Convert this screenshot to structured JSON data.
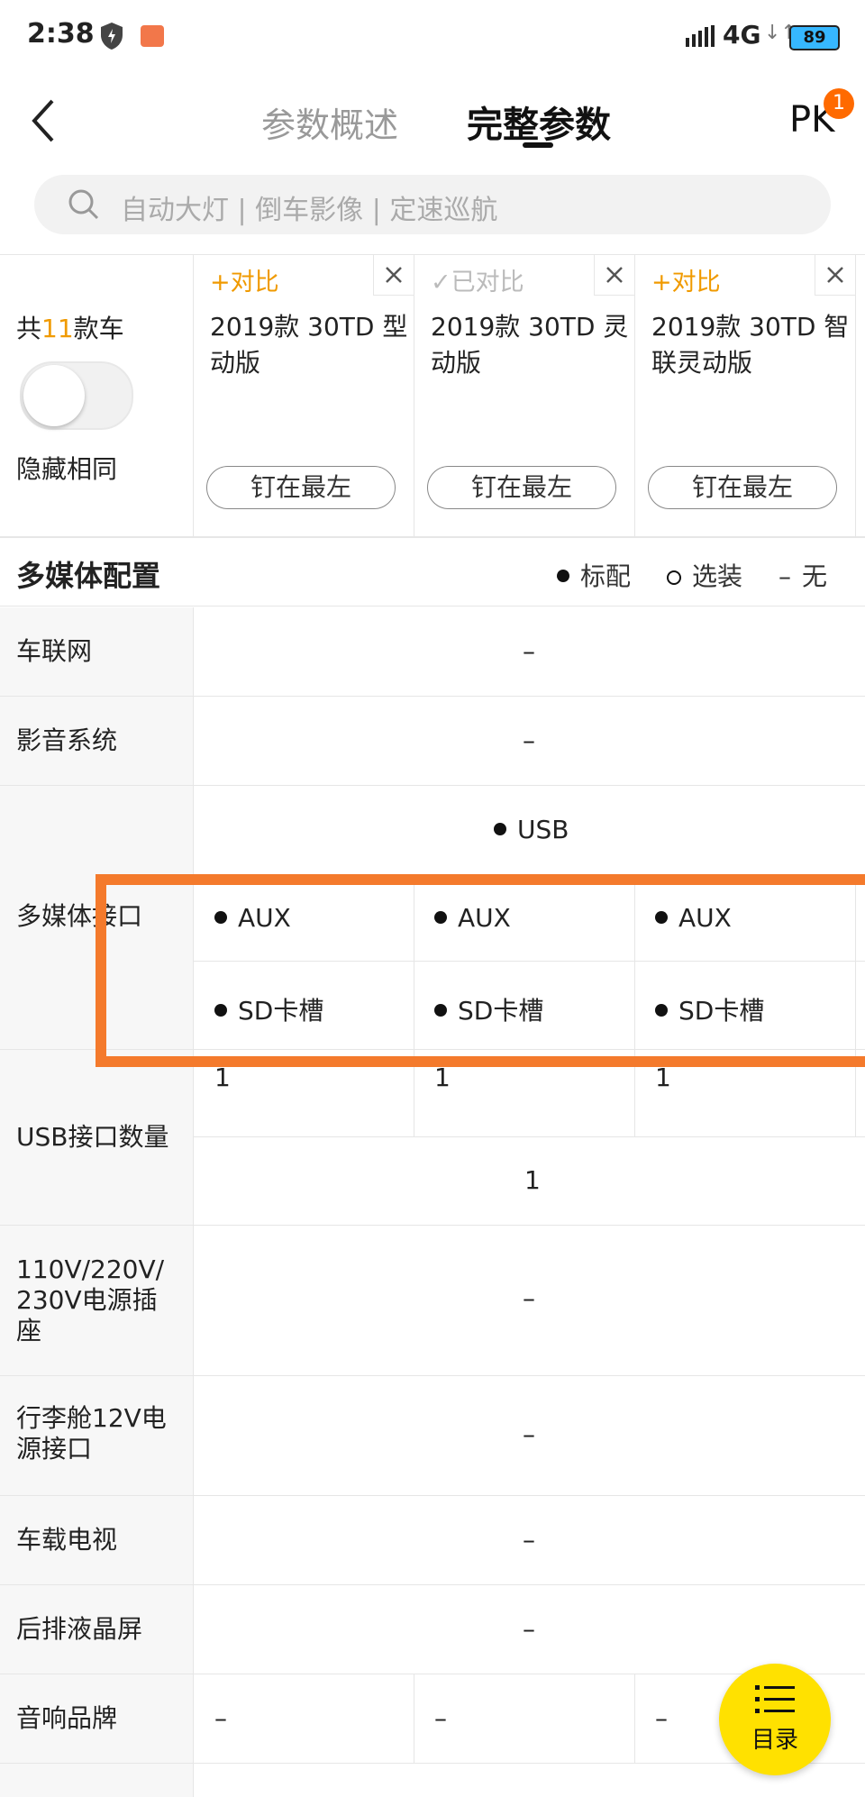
{
  "status": {
    "time": "2:38",
    "network": "4G",
    "battery": "89"
  },
  "header": {
    "tab_overview": "参数概述",
    "tab_full": "完整参数",
    "pk_label": "PK",
    "pk_badge": "1"
  },
  "search": {
    "placeholder": "自动大灯 | 倒车影像 | 定速巡航"
  },
  "compare": {
    "count_prefix": "共",
    "count": "11",
    "count_suffix": "款车",
    "hide_same": "隐藏相同",
    "cars": [
      {
        "compare": "+对比",
        "model": "2019款 30TD 型动版",
        "pin": "钉在最左"
      },
      {
        "compare": "✓已对比",
        "model": "2019款 30TD 灵动版",
        "pin": "钉在最左"
      },
      {
        "compare": "+对比",
        "model": "2019款 30TD 智联灵动版",
        "pin": "钉在最左"
      }
    ]
  },
  "section": {
    "title": "多媒体配置",
    "legend_standard": "标配",
    "legend_optional": "选装",
    "legend_none": "无"
  },
  "rows": {
    "carnet": {
      "label": "车联网",
      "value": "–"
    },
    "av": {
      "label": "影音系统",
      "value": "–"
    },
    "media": {
      "label": "多媒体接口",
      "usb": "USB",
      "aux": "AUX",
      "sd": "SD卡槽"
    },
    "usb_count": {
      "label": "USB接口数量",
      "v1": "1",
      "v2": "1",
      "v3": "1",
      "shared": "1"
    },
    "power": {
      "label": "110V/220V/230V电源插座",
      "value": "–"
    },
    "trunk": {
      "label": "行李舱12V电源接口",
      "value": "–"
    },
    "tv": {
      "label": "车载电视",
      "value": "–"
    },
    "rear_lcd": {
      "label": "后排液晶屏",
      "value": "–"
    },
    "audio_brand": {
      "label": "音响品牌",
      "value": "–"
    }
  },
  "fab": {
    "label": "目录"
  },
  "colors": {
    "accent": "#f09a00",
    "highlight": "#f47a2c",
    "fab": "#ffe100"
  }
}
